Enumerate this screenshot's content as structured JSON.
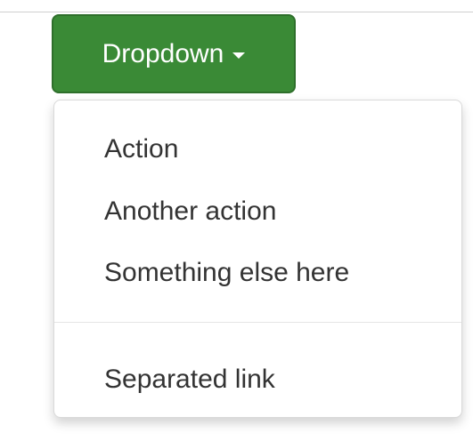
{
  "dropdown": {
    "toggle_label": "Dropdown",
    "caret_icon": "caret-down-icon",
    "button_color": "#3a8a36",
    "menu": {
      "items": [
        {
          "label": "Action"
        },
        {
          "label": "Another action"
        },
        {
          "label": "Something else here"
        }
      ],
      "separated_item": {
        "label": "Separated link"
      }
    }
  }
}
